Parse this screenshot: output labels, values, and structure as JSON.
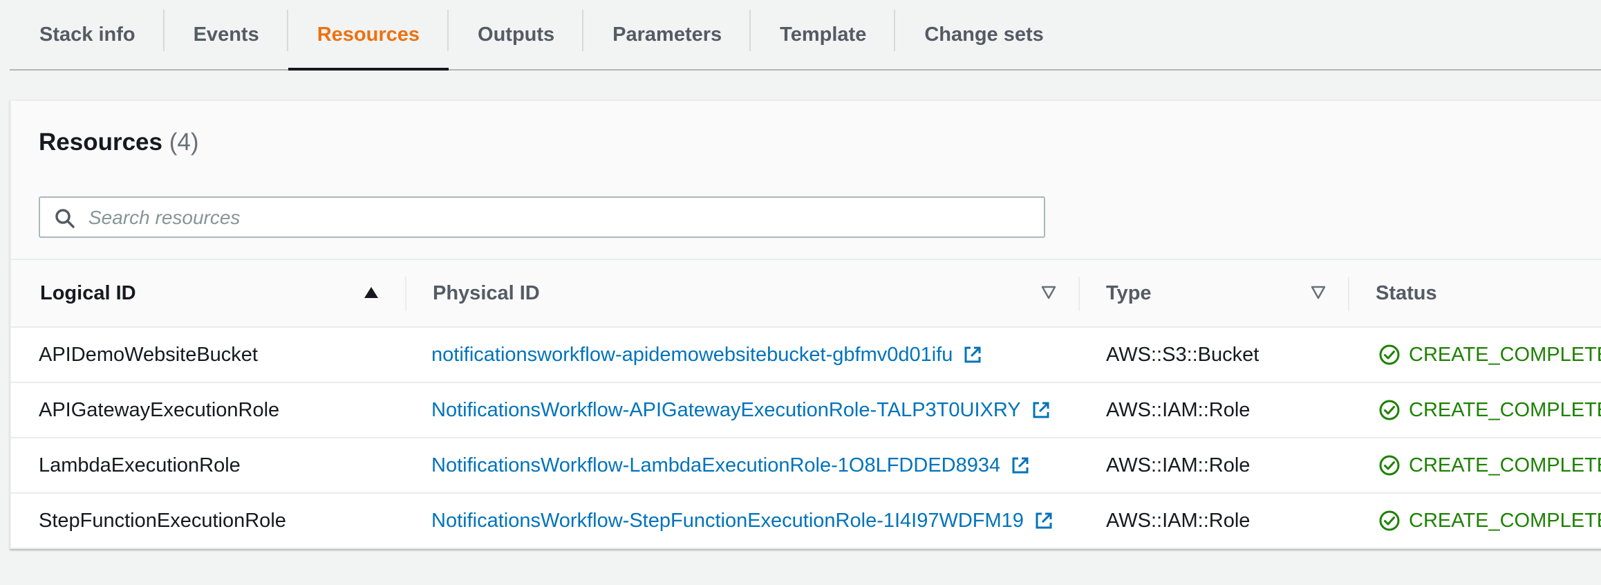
{
  "tabs": [
    {
      "label": "Stack info",
      "active": false
    },
    {
      "label": "Events",
      "active": false
    },
    {
      "label": "Resources",
      "active": true
    },
    {
      "label": "Outputs",
      "active": false
    },
    {
      "label": "Parameters",
      "active": false
    },
    {
      "label": "Template",
      "active": false
    },
    {
      "label": "Change sets",
      "active": false
    }
  ],
  "resources": {
    "title": "Resources",
    "count": "(4)",
    "search_placeholder": "Search resources",
    "columns": {
      "logical_id": "Logical ID",
      "physical_id": "Physical ID",
      "type": "Type",
      "status": "Status"
    },
    "rows": [
      {
        "logical_id": "APIDemoWebsiteBucket",
        "physical_id": "notificationsworkflow-apidemowebsitebucket-gbfmv0d01ifu",
        "type": "AWS::S3::Bucket",
        "status": "CREATE_COMPLETE"
      },
      {
        "logical_id": "APIGatewayExecutionRole",
        "physical_id": "NotificationsWorkflow-APIGatewayExecutionRole-TALP3T0UIXRY",
        "type": "AWS::IAM::Role",
        "status": "CREATE_COMPLETE"
      },
      {
        "logical_id": "LambdaExecutionRole",
        "physical_id": "NotificationsWorkflow-LambdaExecutionRole-1O8LFDDED8934",
        "type": "AWS::IAM::Role",
        "status": "CREATE_COMPLETE"
      },
      {
        "logical_id": "StepFunctionExecutionRole",
        "physical_id": "NotificationsWorkflow-StepFunctionExecutionRole-1I4I97WDFM19",
        "type": "AWS::IAM::Role",
        "status": "CREATE_COMPLETE"
      }
    ]
  },
  "colors": {
    "accent": "#ec7211",
    "link": "#0073bb",
    "success": "#1d8102",
    "text": "#16191f",
    "muted": "#545b64"
  },
  "icons": {
    "search": "search-icon",
    "sort_asc": "sort-ascending-icon",
    "sort_desc": "sort-descending-icon",
    "external": "external-link-icon",
    "status_ok": "status-success-icon"
  }
}
